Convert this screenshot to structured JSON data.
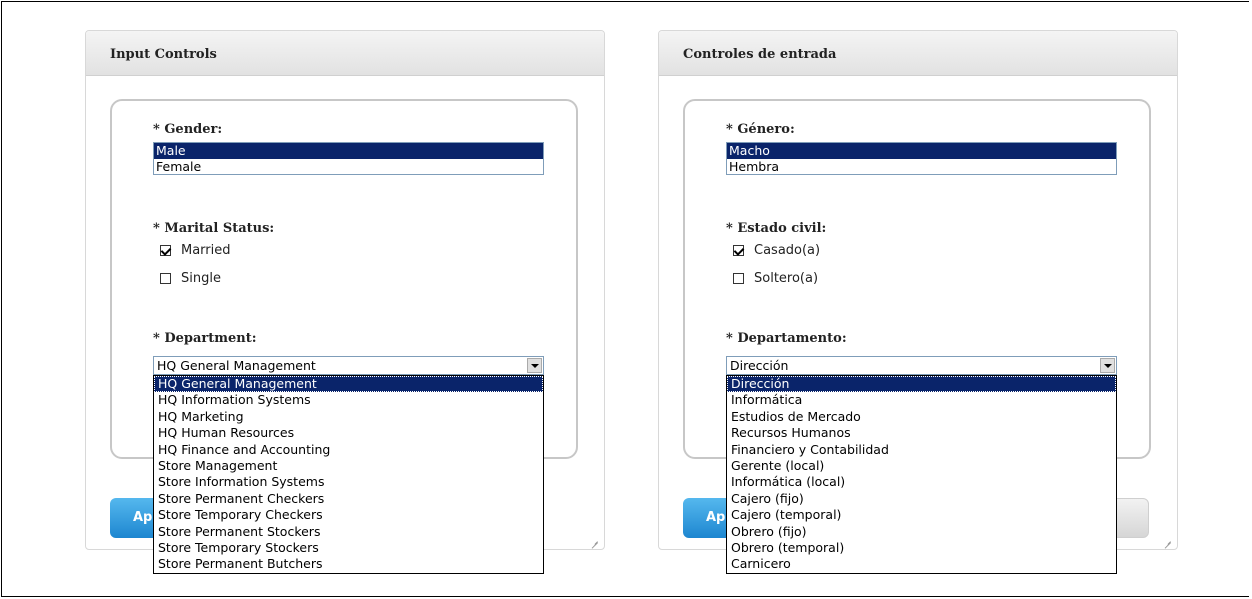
{
  "english": {
    "title": "Input Controls",
    "gender_label": "* Gender:",
    "gender_options": [
      "Male",
      "Female"
    ],
    "gender_selected": "Male",
    "marital_label": "* Marital Status:",
    "marital_options": [
      {
        "label": "Married",
        "checked": true
      },
      {
        "label": "Single",
        "checked": false
      }
    ],
    "department_label": "* Department:",
    "department_value": "HQ General Management",
    "department_options": [
      "HQ General Management",
      "HQ Information Systems",
      "HQ Marketing",
      "HQ Human Resources",
      "HQ Finance and Accounting",
      "Store Management",
      "Store Information Systems",
      "Store Permanent Checkers",
      "Store Temporary Checkers",
      "Store Permanent Stockers",
      "Store Temporary Stockers",
      "Store Permanent Butchers"
    ],
    "apply_label": "Ap"
  },
  "spanish": {
    "title": "Controles de entrada",
    "gender_label": "* Género:",
    "gender_options": [
      "Macho",
      "Hembra"
    ],
    "gender_selected": "Macho",
    "marital_label": "* Estado civil:",
    "marital_options": [
      {
        "label": "Casado(a)",
        "checked": true
      },
      {
        "label": "Soltero(a)",
        "checked": false
      }
    ],
    "department_label": "* Departamento:",
    "department_value": "Dirección",
    "department_options": [
      "Dirección",
      "Informática",
      "Estudios de Mercado",
      "Recursos Humanos",
      "Financiero y Contabilidad",
      "Gerente (local)",
      "Informática (local)",
      "Cajero (fijo)",
      "Cajero (temporal)",
      "Obrero (fijo)",
      "Obrero (temporal)",
      "Carnicero"
    ],
    "apply_label": "Ap"
  },
  "colors": {
    "selection": "#0a246a",
    "apply_button": "#1d86d0"
  }
}
